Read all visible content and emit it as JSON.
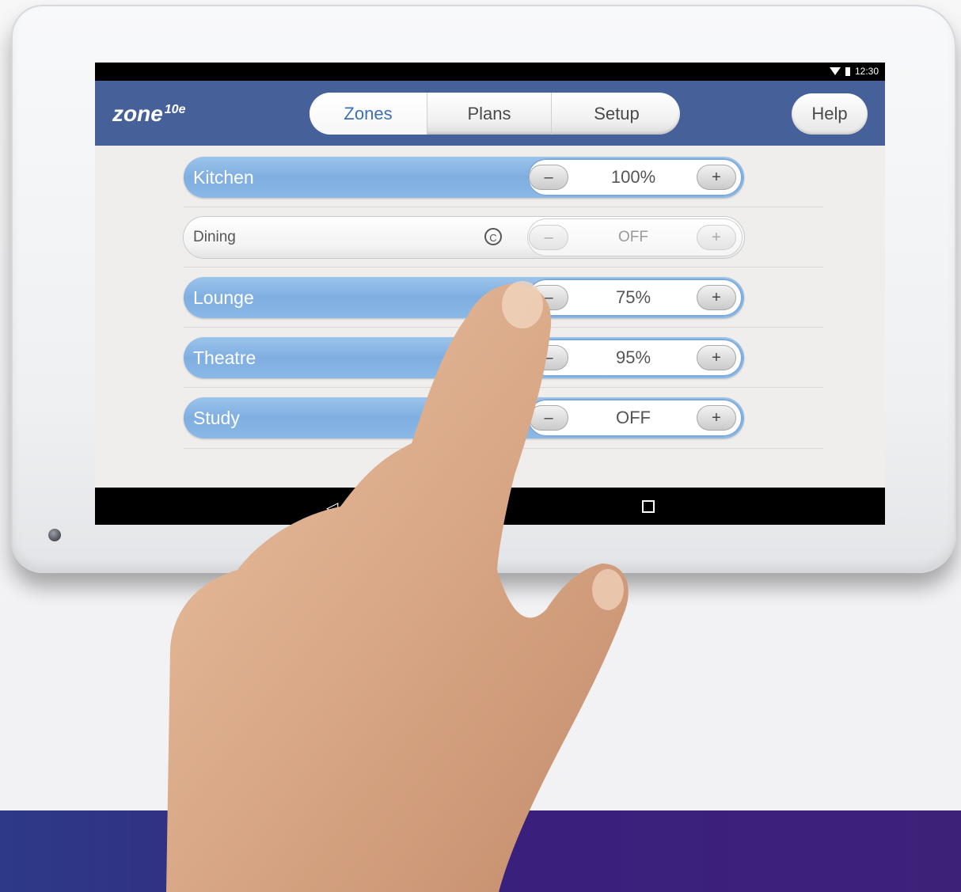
{
  "status_bar": {
    "time": "12:30"
  },
  "header": {
    "logo": "zone",
    "logo_sup": "10e",
    "tabs": [
      {
        "label": "Zones",
        "active": true
      },
      {
        "label": "Plans",
        "active": false
      },
      {
        "label": "Setup",
        "active": false
      }
    ],
    "help_label": "Help"
  },
  "zones": [
    {
      "name": "Kitchen",
      "level": "100%",
      "state": "on",
      "minus": "–",
      "plus": "+"
    },
    {
      "name": "Dining",
      "level": "OFF",
      "state": "off",
      "badge": "C",
      "minus": "–",
      "plus": "+"
    },
    {
      "name": "Lounge",
      "level": "75%",
      "state": "on",
      "minus": "–",
      "plus": "+"
    },
    {
      "name": "Theatre",
      "level": "95%",
      "state": "on",
      "minus": "–",
      "plus": "+"
    },
    {
      "name": "Study",
      "level": "OFF",
      "state": "on",
      "minus": "–",
      "plus": "+"
    }
  ],
  "nav": {
    "back_icon": "back-triangle-icon",
    "recent_icon": "recent-apps-icon"
  },
  "colors": {
    "header": "#46619a",
    "zone_on": "#8ab9e7",
    "band": "#3a1f7d"
  }
}
